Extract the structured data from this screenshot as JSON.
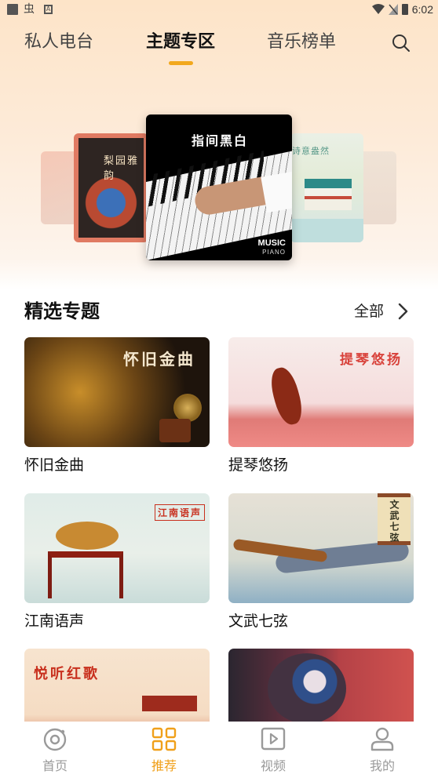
{
  "status_bar": {
    "time": "6:02",
    "bug_glyph": "虫",
    "a_glyph": "A"
  },
  "tabs": [
    {
      "label": "私人电台",
      "active": false
    },
    {
      "label": "主题专区",
      "active": true
    },
    {
      "label": "音乐榜单",
      "active": false
    }
  ],
  "carousel": {
    "center_title": "指间黑白",
    "center_brand_1": "MUSIC",
    "center_brand_2": "PIANO",
    "left_title": "梨园雅韵",
    "right_title": "诗意盎然"
  },
  "section": {
    "title": "精选专题",
    "all_label": "全部"
  },
  "topics": [
    {
      "label": "怀旧金曲",
      "overlay": "怀旧金曲"
    },
    {
      "label": "提琴悠扬",
      "overlay": "提琴悠扬"
    },
    {
      "label": "江南语声",
      "overlay": "江南语声"
    },
    {
      "label": "文武七弦",
      "overlay": "文武七弦"
    },
    {
      "overlay": "悦听红歌"
    },
    {
      "overlay": ""
    }
  ],
  "bottom_nav": [
    {
      "label": "首页",
      "icon": "disc-icon",
      "active": false
    },
    {
      "label": "推荐",
      "icon": "grid-icon",
      "active": true
    },
    {
      "label": "视频",
      "icon": "video-icon",
      "active": false
    },
    {
      "label": "我的",
      "icon": "user-icon",
      "active": false
    }
  ],
  "colors": {
    "accent": "#f0a01a",
    "tab_indicator": "#f2a81d",
    "inactive": "#9a9a9a"
  }
}
